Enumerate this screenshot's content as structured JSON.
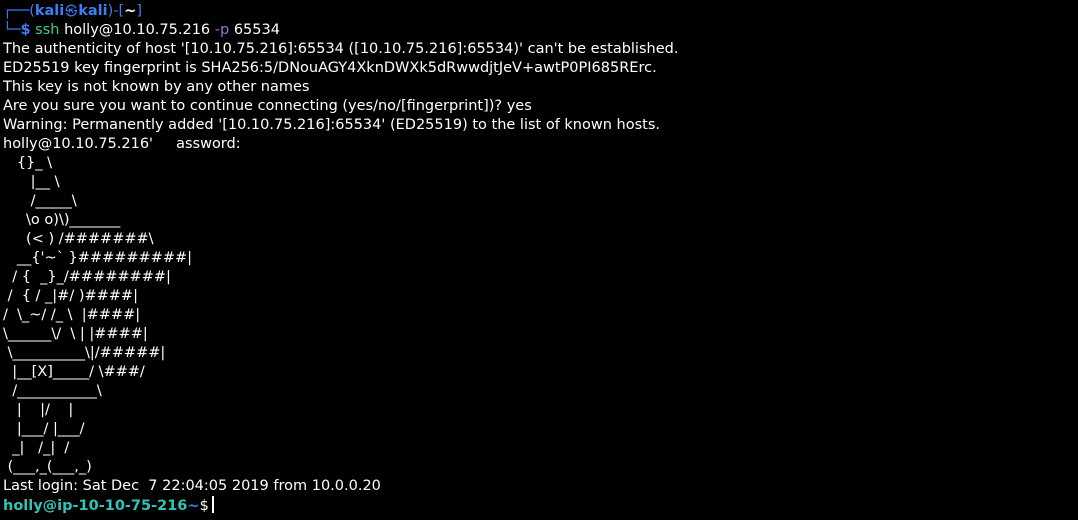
{
  "prompt1": {
    "corner_top": "┌──(",
    "user": "kali",
    "skull": "㉿",
    "host": "kali",
    "sep": ")-[",
    "cwd": "~",
    "close": "]",
    "corner_bottom": "└─",
    "dollar": "$"
  },
  "command": {
    "program": "ssh",
    "target": "holly@10.10.75.216",
    "flag": "-p",
    "port": "65534"
  },
  "output_lines": [
    "The authenticity of host '[10.10.75.216]:65534 ([10.10.75.216]:65534)' can't be established.",
    "ED25519 key fingerprint is SHA256:5/DNouAGY4XknDWXk5dRwwdjtJeV+awtP0PI685RErc.",
    "This key is not known by any other names",
    "Are you sure you want to continue connecting (yes/no/[fingerprint])? yes",
    "Warning: Permanently added '[10.10.75.216]:65534' (ED25519) to the list of known hosts.",
    "holly@10.10.75.216'     assword:"
  ],
  "ascii_art": [
    "   {}_ \\",
    "      |__ \\",
    "      /_____\\",
    "     \\o o)\\)_______",
    "     (< ) /#######\\",
    "   __{'~` }#########|",
    "  / {  _}_/########|",
    " /  { / _|#/ )####|",
    "/  \\_~/ /_ \\  |####|",
    "\\______\\/  \\ | |####|",
    " \\__________\\|/#####|",
    "  |__[X]_____/ \\###/",
    "  /___________\\",
    "   |    |/    |",
    "   |___/ |___/",
    "  _|   /_|  /",
    " (___,_(___,_)"
  ],
  "last_login": "Last login: Sat Dec  7 22:04:05 2019 from 10.0.0.20",
  "prompt2": {
    "user_host": "holly@ip-10-10-75-216",
    "cwd": "~",
    "dollar": "$"
  },
  "colors": {
    "prompt_blue": "#3b7df5",
    "prompt_green": "#44cc88",
    "prompt_teal": "#2ec4b6",
    "flag_purple": "#a46bd8",
    "background": "#000000",
    "text": "#ffffff"
  }
}
